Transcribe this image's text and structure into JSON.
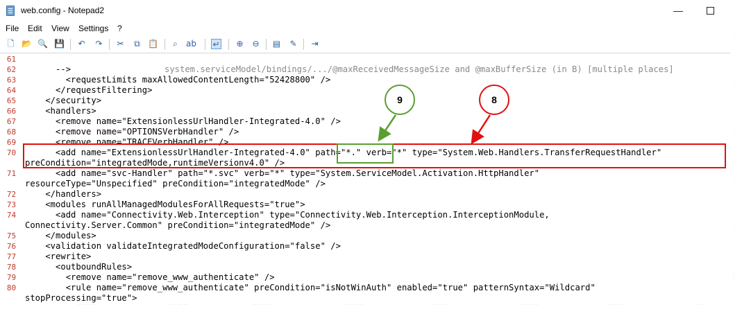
{
  "window": {
    "title": "web.config - Notepad2"
  },
  "controls": {
    "minimize": "—",
    "maximize": ""
  },
  "menu": [
    "File",
    "Edit",
    "View",
    "Settings",
    "?"
  ],
  "toolbar": [
    {
      "icon": "new-file-icon",
      "glyph": "🗋"
    },
    {
      "icon": "open-folder-icon",
      "glyph": "📂"
    },
    {
      "icon": "browse-icon",
      "glyph": "🔍"
    },
    {
      "icon": "save-icon",
      "glyph": "💾"
    },
    {
      "icon": "undo-icon",
      "glyph": "↶"
    },
    {
      "icon": "redo-icon",
      "glyph": "↷"
    },
    {
      "icon": "cut-icon",
      "glyph": "✂"
    },
    {
      "icon": "copy-icon",
      "glyph": "⧉"
    },
    {
      "icon": "paste-icon",
      "glyph": "📋"
    },
    {
      "icon": "find-icon",
      "glyph": "⌕"
    },
    {
      "icon": "replace-icon",
      "glyph": "ab"
    },
    {
      "icon": "word-wrap-icon",
      "glyph": "↵"
    },
    {
      "icon": "zoom-in-icon",
      "glyph": "⊕"
    },
    {
      "icon": "zoom-out-icon",
      "glyph": "⊖"
    },
    {
      "icon": "scheme-icon",
      "glyph": "▤"
    },
    {
      "icon": "customize-icon",
      "glyph": "✎"
    },
    {
      "icon": "exit-icon",
      "glyph": "⇥"
    }
  ],
  "hint": "system.serviceModel/bindings/.../@maxReceivedMessageSize and @maxBufferSize (in B) [multiple places]",
  "lines": [
    {
      "n": "61",
      "text": ""
    },
    {
      "n": "62",
      "text": "      -->"
    },
    {
      "n": "63",
      "text": "        <requestLimits maxAllowedContentLength=\"52428800\" />"
    },
    {
      "n": "64",
      "text": "      </requestFiltering>"
    },
    {
      "n": "65",
      "text": "    </security>"
    },
    {
      "n": "66",
      "text": "    <handlers>"
    },
    {
      "n": "67",
      "text": "      <remove name=\"ExtensionlessUrlHandler-Integrated-4.0\" />"
    },
    {
      "n": "68",
      "text": "      <remove name=\"OPTIONSVerbHandler\" />"
    },
    {
      "n": "69",
      "text": "      <remove name=\"TRACEVerbHandler\" />"
    },
    {
      "n": "70",
      "text": "      <add name=\"ExtensionlessUrlHandler-Integrated-4.0\" path=\"*.\" verb=\"*\" type=\"System.Web.Handlers.TransferRequestHandler\""
    },
    {
      "n": "",
      "text": "preCondition=\"integratedMode,runtimeVersionv4.0\" />"
    },
    {
      "n": "71",
      "text": "      <add name=\"svc-Handler\" path=\"*.svc\" verb=\"*\" type=\"System.ServiceModel.Activation.HttpHandler\""
    },
    {
      "n": "",
      "text": "resourceType=\"Unspecified\" preCondition=\"integratedMode\" />"
    },
    {
      "n": "72",
      "text": "    </handlers>"
    },
    {
      "n": "73",
      "text": "    <modules runAllManagedModulesForAllRequests=\"true\">"
    },
    {
      "n": "74",
      "text": "      <add name=\"Connectivity.Web.Interception\" type=\"Connectivity.Web.Interception.InterceptionModule,"
    },
    {
      "n": "",
      "text": "Connectivity.Server.Common\" preCondition=\"integratedMode\" />"
    },
    {
      "n": "75",
      "text": "    </modules>"
    },
    {
      "n": "76",
      "text": "    <validation validateIntegratedModeConfiguration=\"false\" />"
    },
    {
      "n": "77",
      "text": "    <rewrite>"
    },
    {
      "n": "78",
      "text": "      <outboundRules>"
    },
    {
      "n": "79",
      "text": "        <remove name=\"remove_www_authenticate\" />"
    },
    {
      "n": "80",
      "text": "        <rule name=\"remove_www_authenticate\" preCondition=\"isNotWinAuth\" enabled=\"true\" patternSyntax=\"Wildcard\""
    },
    {
      "n": "",
      "text": "stopProcessing=\"true\">"
    }
  ],
  "annotations": {
    "green_label": "9",
    "red_label": "8",
    "green_color": "#5a9e2f",
    "red_color": "#e01010"
  }
}
